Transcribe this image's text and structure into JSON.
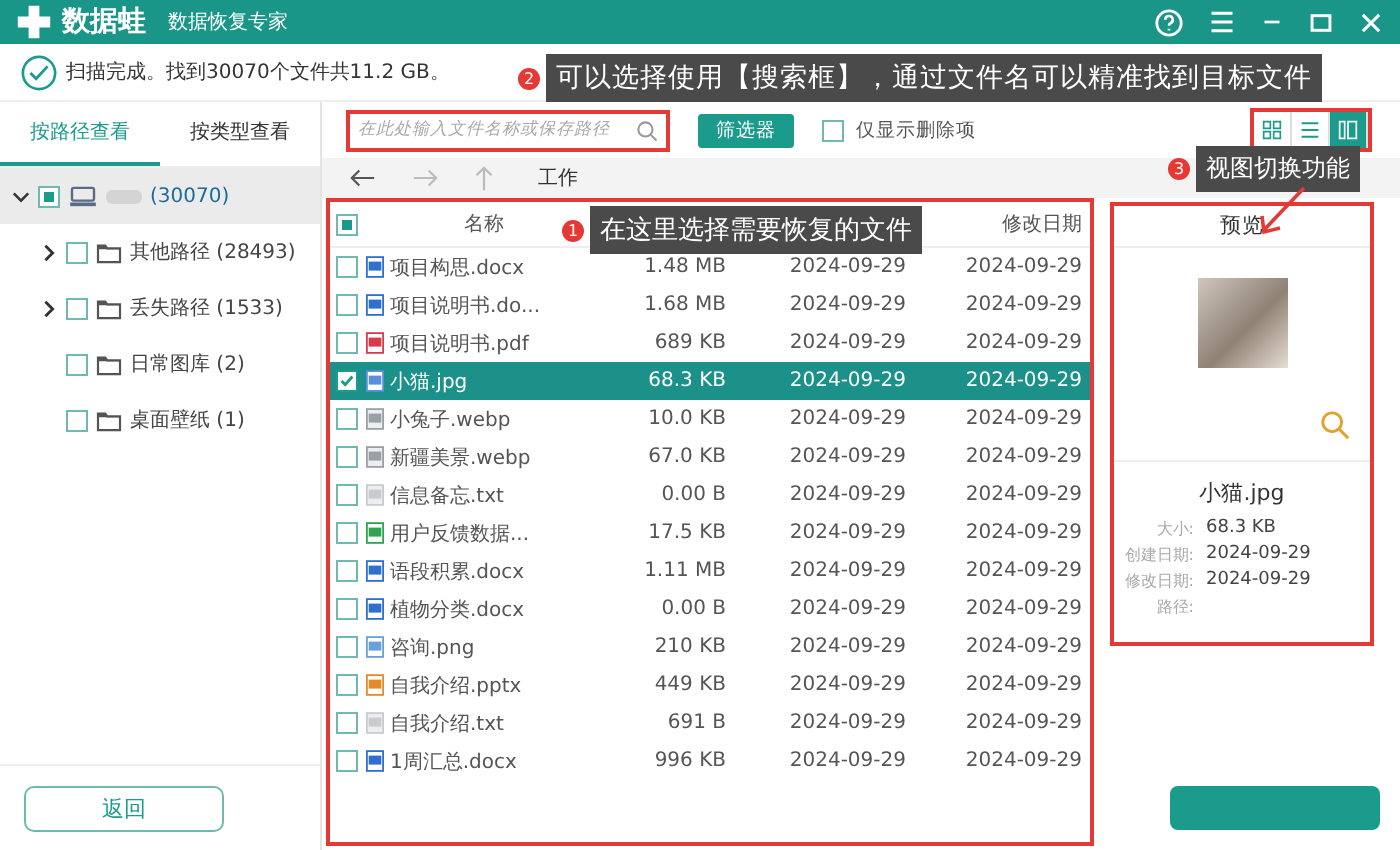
{
  "window": {
    "app_name": "数据蛙",
    "subtitle": "数据恢复专家"
  },
  "status": "扫描完成。找到30070个文件共11.2 GB。",
  "view_tabs": [
    {
      "label": "按路径查看",
      "selected": true
    },
    {
      "label": "按类型查看",
      "selected": false
    }
  ],
  "tree": [
    {
      "label": "(30070)",
      "partial": true,
      "expanded": true,
      "selected": true,
      "children": [
        {
          "label": "其他路径 (28493)",
          "checked": false,
          "expanded": false,
          "has_children": true,
          "selected": false
        },
        {
          "label": "丢失路径 (1533)",
          "checked": false,
          "expanded": false,
          "has_children": true,
          "selected": false
        },
        {
          "label": "日常图库 (2)",
          "checked": false,
          "has_children": false,
          "selected": false
        },
        {
          "label": "桌面壁纸 (1)",
          "checked": false,
          "has_children": false,
          "selected": false
        }
      ]
    }
  ],
  "back_button": "返回",
  "search": {
    "placeholder": "在此处输入文件名称或保存路径"
  },
  "filter_button": "筛选器",
  "deleted_only": {
    "label": "仅显示删除项",
    "checked": false
  },
  "view_modes": [
    {
      "kind": "grid",
      "selected": false
    },
    {
      "kind": "list",
      "selected": false
    },
    {
      "kind": "preview",
      "selected": true
    }
  ],
  "path": "工作",
  "table": {
    "header_partial": true,
    "columns": [
      "名称",
      "",
      "",
      "修改日期"
    ],
    "rows": [
      {
        "kind": "word",
        "name": "项目构思.docx",
        "size": "1.48 MB",
        "created": "2024-09-29",
        "modified": "2024-09-29",
        "checked": false,
        "selected": false
      },
      {
        "kind": "word",
        "name": "项目说明书.do...",
        "size": "1.68 MB",
        "created": "2024-09-29",
        "modified": "2024-09-29",
        "checked": false,
        "selected": false
      },
      {
        "kind": "pdf",
        "name": "项目说明书.pdf",
        "size": "689 KB",
        "created": "2024-09-29",
        "modified": "2024-09-29",
        "checked": false,
        "selected": false
      },
      {
        "kind": "image",
        "name": "小猫.jpg",
        "size": "68.3 KB",
        "created": "2024-09-29",
        "modified": "2024-09-29",
        "checked": true,
        "selected": true
      },
      {
        "kind": "webp",
        "name": "小兔子.webp",
        "size": "10.0 KB",
        "created": "2024-09-29",
        "modified": "2024-09-29",
        "checked": false,
        "selected": false
      },
      {
        "kind": "webp",
        "name": "新疆美景.webp",
        "size": "67.0 KB",
        "created": "2024-09-29",
        "modified": "2024-09-29",
        "checked": false,
        "selected": false
      },
      {
        "kind": "text",
        "name": "信息备忘.txt",
        "size": "0.00 B",
        "created": "2024-09-29",
        "modified": "2024-09-29",
        "checked": false,
        "selected": false
      },
      {
        "kind": "sheet",
        "name": "用户反馈数据...",
        "size": "17.5 KB",
        "created": "2024-09-29",
        "modified": "2024-09-29",
        "checked": false,
        "selected": false
      },
      {
        "kind": "word",
        "name": "语段积累.docx",
        "size": "1.11 MB",
        "created": "2024-09-29",
        "modified": "2024-09-29",
        "checked": false,
        "selected": false
      },
      {
        "kind": "word",
        "name": "植物分类.docx",
        "size": "0.00 B",
        "created": "2024-09-29",
        "modified": "2024-09-29",
        "checked": false,
        "selected": false
      },
      {
        "kind": "png",
        "name": "咨询.png",
        "size": "210 KB",
        "created": "2024-09-29",
        "modified": "2024-09-29",
        "checked": false,
        "selected": false
      },
      {
        "kind": "slides",
        "name": "自我介绍.pptx",
        "size": "449 KB",
        "created": "2024-09-29",
        "modified": "2024-09-29",
        "checked": false,
        "selected": false
      },
      {
        "kind": "text",
        "name": "自我介绍.txt",
        "size": "691 B",
        "created": "2024-09-29",
        "modified": "2024-09-29",
        "checked": false,
        "selected": false
      },
      {
        "kind": "word",
        "name": "1周汇总.docx",
        "size": "996 KB",
        "created": "2024-09-29",
        "modified": "2024-09-29",
        "checked": false,
        "selected": false
      }
    ]
  },
  "preview": {
    "title": "预览",
    "file_name": "小猫.jpg",
    "details": [
      {
        "label": "大小:",
        "value": "68.3 KB"
      },
      {
        "label": "创建日期:",
        "value": "2024-09-29"
      },
      {
        "label": "修改日期:",
        "value": "2024-09-29"
      },
      {
        "label": "路径:"
      }
    ]
  },
  "annotations": [
    {
      "number": "2",
      "text": "可以选择使用【搜索框】，通过文件名可以精准找到目标文件"
    },
    {
      "number": "3",
      "text": "视图切换功能"
    },
    {
      "number": "1",
      "text": "在这里选择需要恢复的文件"
    }
  ]
}
